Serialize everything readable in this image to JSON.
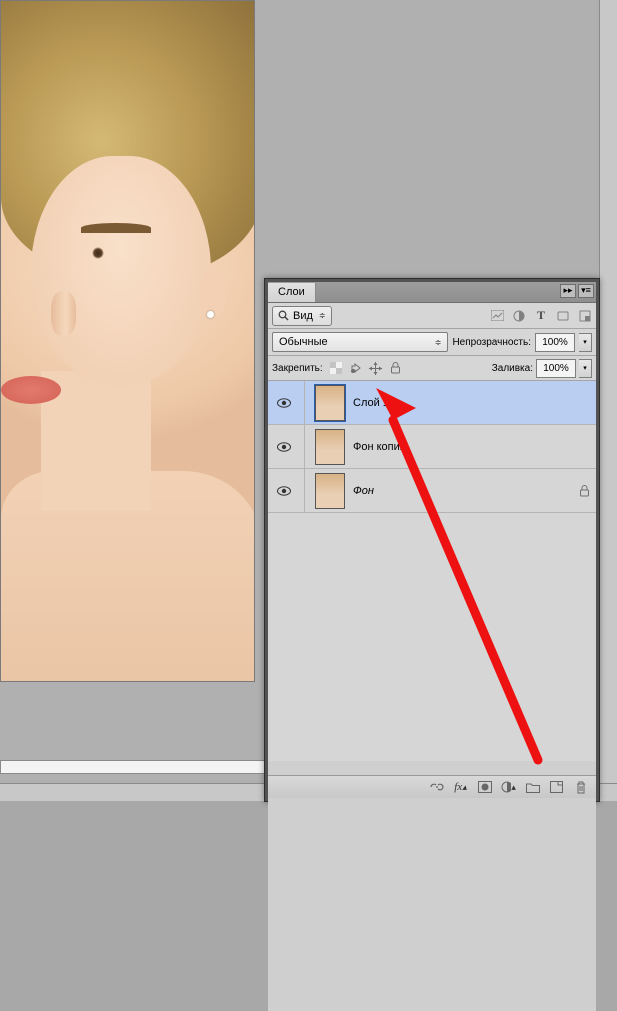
{
  "panel": {
    "title": "Слои",
    "kind_label": "Вид",
    "blend_mode": "Обычные",
    "opacity_label": "Непрозрачность:",
    "opacity_value": "100%",
    "lock_label": "Закрепить:",
    "fill_label": "Заливка:",
    "fill_value": "100%"
  },
  "filter_icons": [
    "image-icon",
    "adjust-icon",
    "type-icon",
    "shape-icon",
    "smart-icon"
  ],
  "lock_icons": [
    "lock-transparent-icon",
    "lock-pixels-icon",
    "lock-position-icon",
    "lock-all-icon"
  ],
  "layers": [
    {
      "name": "Слой 1",
      "visible": true,
      "locked": false,
      "selected": true
    },
    {
      "name": "Фон копия",
      "visible": true,
      "locked": false,
      "selected": false
    },
    {
      "name": "Фон",
      "visible": true,
      "locked": true,
      "selected": false,
      "bg": true
    }
  ],
  "footer_icons": [
    "link-icon",
    "fx-icon",
    "mask-icon",
    "adjustment-icon",
    "group-icon",
    "new-layer-icon",
    "trash-icon"
  ]
}
